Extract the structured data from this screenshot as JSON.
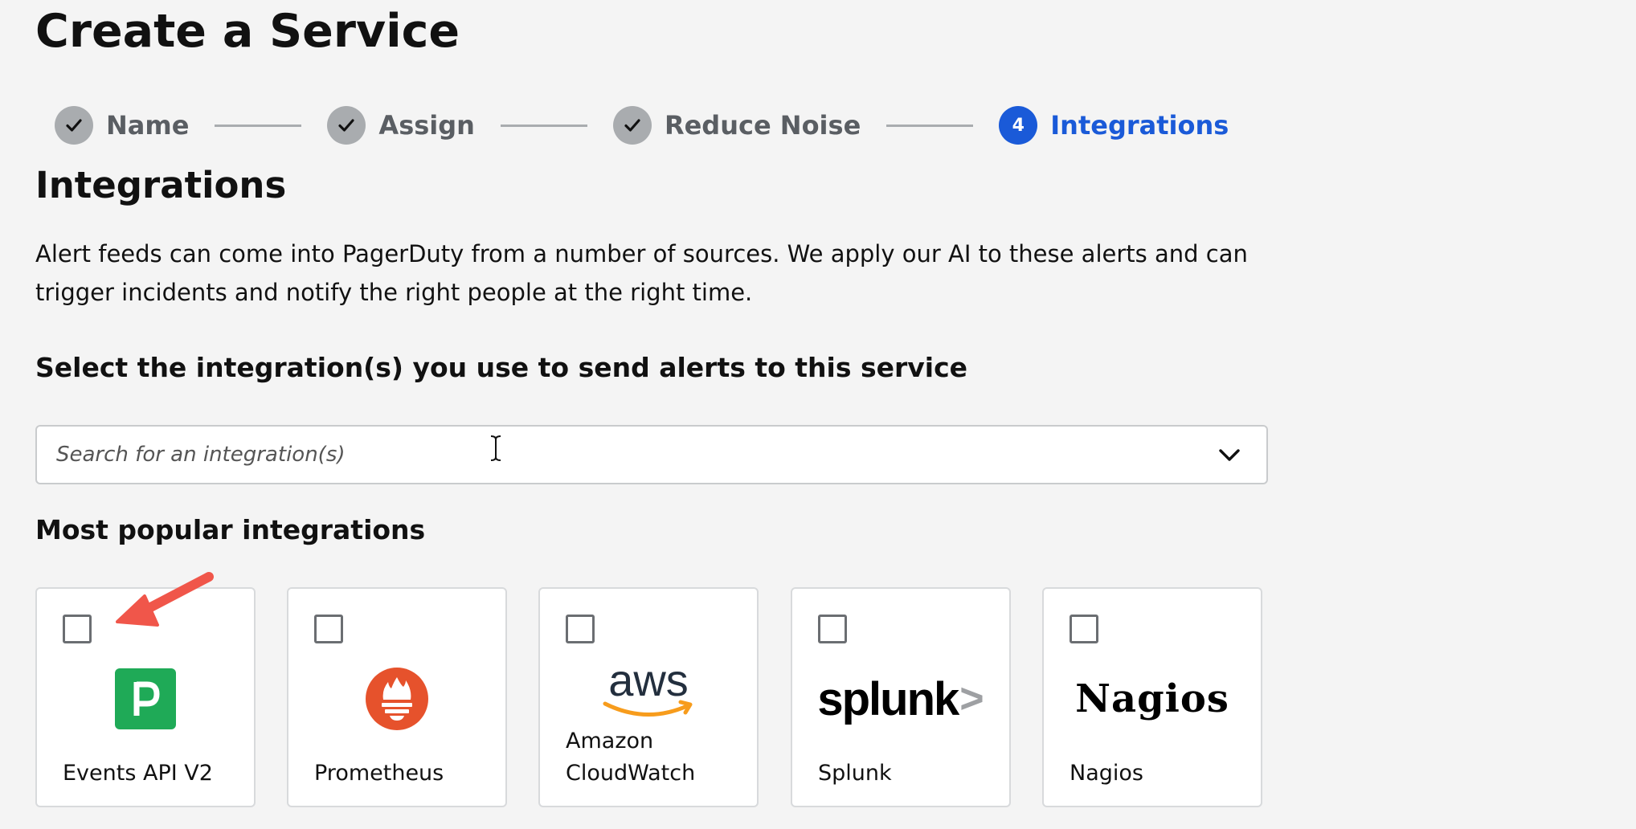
{
  "page": {
    "title": "Create a Service"
  },
  "stepper": {
    "steps": [
      {
        "label": "Name",
        "status": "done"
      },
      {
        "label": "Assign",
        "status": "done"
      },
      {
        "label": "Reduce Noise",
        "status": "done"
      },
      {
        "label": "Integrations",
        "status": "active",
        "number": "4"
      }
    ]
  },
  "section": {
    "title": "Integrations",
    "description": "Alert feeds can come into PagerDuty from a number of sources. We apply our AI to these alerts and can trigger incidents and notify the right people at the right time."
  },
  "select": {
    "heading": "Select the integration(s) you use to send alerts to this service",
    "placeholder": "Search for an integration(s)",
    "value": ""
  },
  "popular": {
    "heading": "Most popular integrations",
    "items": [
      {
        "label": "Events API V2",
        "checked": false,
        "icon": "pagerduty-logo-icon",
        "logo_text": "P"
      },
      {
        "label": "Prometheus",
        "checked": false,
        "icon": "prometheus-logo-icon"
      },
      {
        "label": "Amazon CloudWatch",
        "checked": false,
        "icon": "aws-logo-icon",
        "logo_text": "aws"
      },
      {
        "label": "Splunk",
        "checked": false,
        "icon": "splunk-logo-icon",
        "logo_text": "splunk",
        "logo_suffix": ">"
      },
      {
        "label": "Nagios",
        "checked": false,
        "icon": "nagios-logo-icon",
        "logo_text": "Nagios"
      }
    ]
  },
  "colors": {
    "accent": "#1a5ad8",
    "done": "#a9acaf",
    "pagerduty_green": "#1faa57",
    "prometheus_orange": "#e6522c",
    "aws_orange": "#f79c1c",
    "annotation_arrow": "#f0564a"
  }
}
